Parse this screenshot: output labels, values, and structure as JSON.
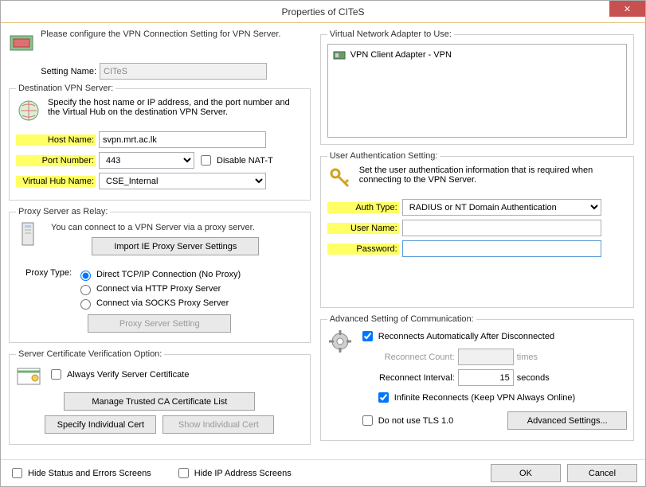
{
  "title": "Properties of CITeS",
  "intro_text": "Please configure the VPN Connection Setting for VPN Server.",
  "setting_name_label": "Setting Name:",
  "setting_name_value": "CITeS",
  "dest": {
    "legend": "Destination VPN Server:",
    "desc": "Specify the host name or IP address, and the port number and the Virtual Hub on the destination VPN Server.",
    "host_label": "Host Name:",
    "host_value": "svpn.mrt.ac.lk",
    "port_label": "Port Number:",
    "port_value": "443",
    "disable_nat_label": "Disable NAT-T",
    "hub_label": "Virtual Hub Name:",
    "hub_value": "CSE_Internal"
  },
  "proxy": {
    "legend": "Proxy Server as Relay:",
    "desc": "You can connect to a VPN Server via a proxy server.",
    "import_btn": "Import IE Proxy Server Settings",
    "type_label": "Proxy Type:",
    "opt1": "Direct TCP/IP Connection (No Proxy)",
    "opt2": "Connect via HTTP Proxy Server",
    "opt3": "Connect via SOCKS Proxy Server",
    "setting_btn": "Proxy Server Setting"
  },
  "cert": {
    "legend": "Server Certificate Verification Option:",
    "always_label": "Always Verify Server Certificate",
    "manage_btn": "Manage Trusted CA Certificate List",
    "specify_btn": "Specify Individual Cert",
    "show_btn": "Show Individual Cert"
  },
  "adapter": {
    "legend": "Virtual Network Adapter to Use:",
    "item": "VPN Client Adapter - VPN"
  },
  "auth": {
    "legend": "User Authentication Setting:",
    "desc": "Set the user authentication information that is required when connecting to the VPN Server.",
    "type_label": "Auth Type:",
    "type_value": "RADIUS or NT Domain Authentication",
    "user_label": "User Name:",
    "user_value": "",
    "pass_label": "Password:",
    "pass_value": ""
  },
  "adv": {
    "legend": "Advanced Setting of Communication:",
    "reconnect_label": "Reconnects Automatically After Disconnected",
    "count_label": "Reconnect Count:",
    "count_value": "",
    "times": "times",
    "interval_label": "Reconnect Interval:",
    "interval_value": "15",
    "seconds": "seconds",
    "infinite_label": "Infinite Reconnects (Keep VPN Always Online)",
    "tls_label": "Do not use TLS 1.0",
    "adv_btn": "Advanced Settings..."
  },
  "bottom": {
    "hide_status": "Hide Status and Errors Screens",
    "hide_ip": "Hide IP Address Screens",
    "ok": "OK",
    "cancel": "Cancel"
  }
}
